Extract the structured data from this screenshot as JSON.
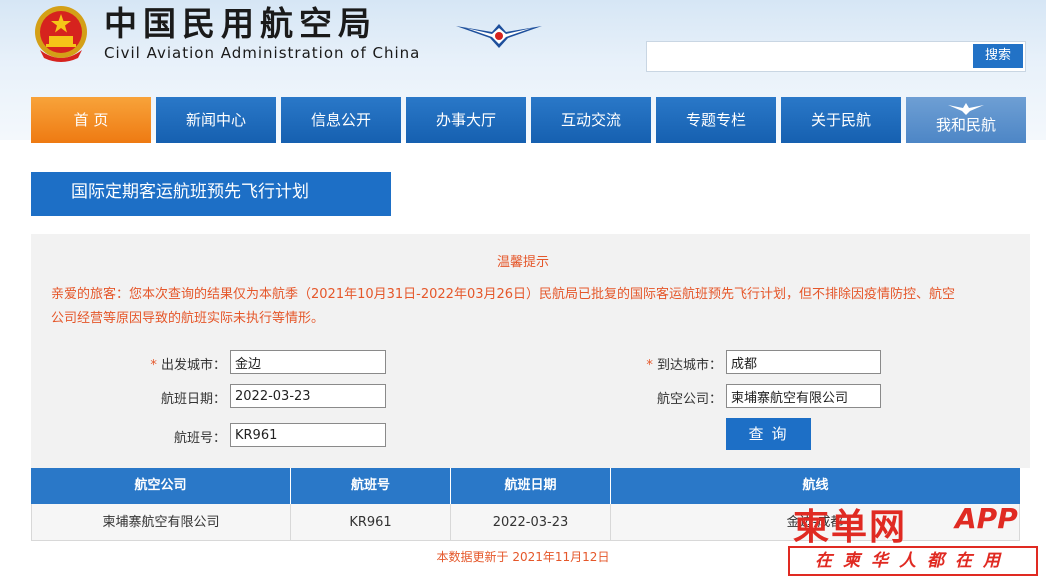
{
  "header": {
    "title_cn": "中国民用航空局",
    "title_en": "Civil Aviation Administration of China",
    "search_button": "搜索",
    "search_value": ""
  },
  "nav": {
    "items": [
      {
        "label": "首 页"
      },
      {
        "label": "新闻中心"
      },
      {
        "label": "信息公开"
      },
      {
        "label": "办事大厅"
      },
      {
        "label": "互动交流"
      },
      {
        "label": "专题专栏"
      },
      {
        "label": "关于民航"
      },
      {
        "label": "我和民航"
      }
    ]
  },
  "section": {
    "title": "国际定期客运航班预先飞行计划"
  },
  "notice": {
    "title": "温馨提示",
    "line1": "亲爱的旅客：您本次查询的结果仅为本航季（2021年10月31日-2022年03月26日）民航局已批复的国际客运航班预先飞行计划，但不排除因疫情防控、航空",
    "line2": "公司经营等原因导致的航班实际未执行等情形。"
  },
  "form": {
    "depart_label": "出发城市：",
    "depart_value": "金边",
    "arrive_label": "到达城市：",
    "arrive_value": "成都",
    "date_label": "航班日期：",
    "date_value": "2022-03-23",
    "airline_label": "航空公司：",
    "airline_value": "柬埔寨航空有限公司",
    "flight_label": "航班号：",
    "flight_value": "KR961",
    "required_mark": "*",
    "query_button": "查询"
  },
  "table": {
    "headers": [
      "航空公司",
      "航班号",
      "航班日期",
      "航线"
    ],
    "rows": [
      [
        "柬埔寨航空有限公司",
        "KR961",
        "2022-03-23",
        "金边-成都"
      ]
    ]
  },
  "footer": {
    "update_text": "本数据更新于 2021年11月12日"
  },
  "watermark": {
    "big": "柬单网",
    "app": "APP",
    "slogan": "在柬华人都在用"
  },
  "colors": {
    "brand_blue": "#1d6fc6",
    "accent_orange": "#ee7a12",
    "notice_red": "#e5572a"
  }
}
